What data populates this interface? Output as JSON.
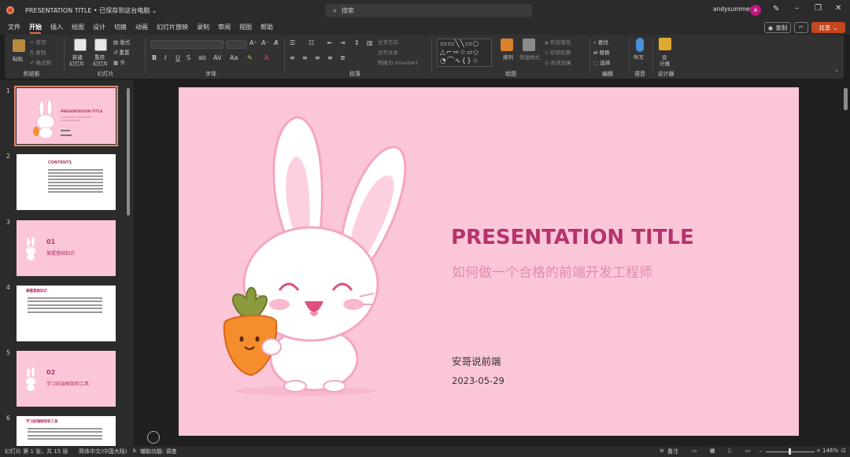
{
  "titlebar": {
    "doc_title": "PRESENTATION TITLE • 已保存到这台电脑 ⌄",
    "search_placeholder": "搜索",
    "user_name": "andysummer",
    "avatar_letter": "A"
  },
  "menu": {
    "tabs": [
      "文件",
      "开始",
      "插入",
      "绘图",
      "设计",
      "切换",
      "动画",
      "幻灯片放映",
      "录制",
      "审阅",
      "视图",
      "帮助"
    ],
    "active": "开始",
    "record_label": "录制",
    "share_label": "共享"
  },
  "ribbon": {
    "groups": {
      "clipboard": "剪贴板",
      "slides": "幻灯片",
      "font": "字体",
      "paragraph": "段落",
      "drawing": "绘图",
      "editing": "编辑",
      "voice": "语音",
      "designer": "设计器"
    },
    "paste": "粘贴",
    "cut": "剪切",
    "copy": "复制",
    "format_painter": "格式刷",
    "new_slide_1": "新建",
    "new_slide_2": "幻灯片",
    "reuse_1": "重用",
    "reuse_2": "幻灯片",
    "layout": "版式",
    "reset": "重置",
    "section": "节",
    "text_direction": "文字方向",
    "align_text": "对齐文本",
    "smartart": "转换为 SmartArt",
    "arrange": "排列",
    "quick_styles": "快速样式",
    "shape_fill": "形状填充",
    "shape_outline": "形状轮廓",
    "shape_effects": "形状效果",
    "find": "查找",
    "replace": "替换",
    "select": "选择",
    "dictate": "听写",
    "designer_1": "设",
    "designer_2": "计器"
  },
  "thumbnails": {
    "numbers": [
      "1",
      "2",
      "3",
      "4",
      "5",
      "6"
    ],
    "t1_title": "PRESENTATION TITLE",
    "t2_title": "CONTENTS",
    "t3_num": "01",
    "t3_title": "掌握基础知识",
    "t4_title": "掌握基础知识",
    "t5_num": "02",
    "t5_title": "学习前端框架和工具",
    "t6_title": "学习前端框架和工具"
  },
  "slide": {
    "title": "PRESENTATION TITLE",
    "subtitle": "如何做一个合格的前端开发工程师",
    "author": "安哥说前端",
    "date": "2023-05-29"
  },
  "status": {
    "slide_info": "幻灯片 第 1 张，共 15 张",
    "language": "简体中文(中国大陆)",
    "accessibility": "辅助功能: 调查",
    "notes": "备注",
    "zoom": "146%"
  },
  "colors": {
    "slide_bg": "#fcc6d9",
    "title_color": "#b5336a",
    "subtitle_color": "#e08cb0",
    "accent": "#c4471f"
  }
}
